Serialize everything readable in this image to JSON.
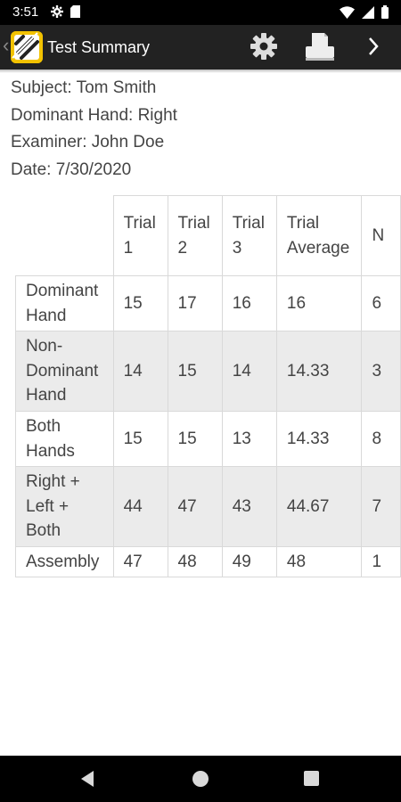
{
  "status_bar": {
    "time": "3:51",
    "left_icons": [
      "gear-icon",
      "sd-card-icon"
    ],
    "right_icons": [
      "wifi-icon",
      "signal-icon",
      "battery-icon"
    ]
  },
  "app_bar": {
    "title": "Test Summary",
    "back_glyph": "‹",
    "actions": [
      "settings",
      "print",
      "next"
    ],
    "colors": {
      "background": "#222222",
      "logo": "#f2c200"
    }
  },
  "info": {
    "subject": "Subject: Tom Smith",
    "dominant_hand": "Dominant Hand: Right",
    "examiner": "Examiner: John Doe",
    "date": "Date: 7/30/2020"
  },
  "table": {
    "headers": [
      "Trial 1",
      "Trial 2",
      "Trial 3",
      "Trial Average",
      "N"
    ],
    "rows": [
      {
        "label": "Dominant Hand",
        "values": [
          "15",
          "17",
          "16",
          "16",
          "6"
        ]
      },
      {
        "label": "Non-Dominant Hand",
        "values": [
          "14",
          "15",
          "14",
          "14.33",
          "3"
        ]
      },
      {
        "label": "Both Hands",
        "values": [
          "15",
          "15",
          "13",
          "14.33",
          "8"
        ]
      },
      {
        "label": "Right + Left + Both",
        "values": [
          "44",
          "47",
          "43",
          "44.67",
          "7"
        ]
      },
      {
        "label": "Assembly",
        "values": [
          "47",
          "48",
          "49",
          "48",
          "1"
        ]
      }
    ],
    "colors": {
      "shaded_row": "#ebebeb",
      "border": "#d9d9d9"
    }
  },
  "nav_bar": {
    "buttons": [
      "back",
      "home",
      "recents"
    ]
  }
}
